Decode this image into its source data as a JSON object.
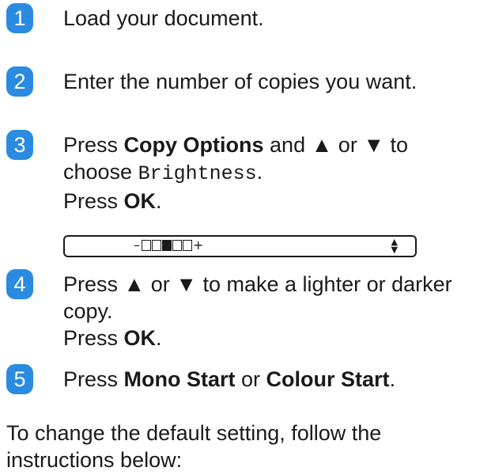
{
  "steps": [
    {
      "num": "1",
      "lines": [
        "Load your document."
      ]
    },
    {
      "num": "2",
      "lines": [
        "Enter the number of copies you want."
      ]
    },
    {
      "num": "3",
      "press": "Press ",
      "copy_options": "Copy Options",
      "and_up_or_down": " and ▲ or ▼ to",
      "choose": "choose ",
      "brightness": "Brightness",
      "period": ".",
      "press_ok_prefix": "Press ",
      "ok": "OK",
      "ok_period": "."
    },
    {
      "num": "4",
      "line1": "Press ▲ or ▼ to make a lighter or darker",
      "line2": "copy.",
      "press_ok_prefix": "Press ",
      "ok": "OK",
      "ok_period": "."
    },
    {
      "num": "5",
      "press": "Press ",
      "mono_start": "Mono Start",
      "or": " or ",
      "colour_start": "Colour Start",
      "period": "."
    }
  ],
  "lcd": {
    "minus": "–",
    "plus": "+",
    "level": 3,
    "cells": 5,
    "up": "▲",
    "down": "▼"
  },
  "note": "To change the default setting, follow the instructions below:"
}
